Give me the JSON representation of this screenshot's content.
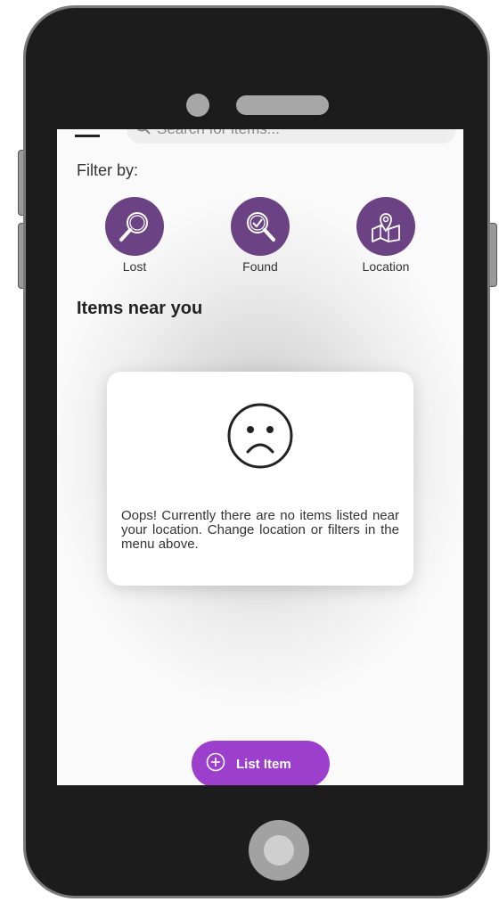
{
  "search": {
    "placeholder": "Search for items..."
  },
  "filter": {
    "label": "Filter by:",
    "items": [
      {
        "label": "Lost",
        "icon": "magnifier-icon"
      },
      {
        "label": "Found",
        "icon": "magnifier-check-icon"
      },
      {
        "label": "Location",
        "icon": "map-pin-icon"
      }
    ]
  },
  "section": {
    "title": "Items near you"
  },
  "empty_state": {
    "icon": "sad-face-icon",
    "message": "Oops! Currently there are no items listed near your location. Change location or filters in the menu above."
  },
  "fab": {
    "label": "List Item",
    "icon": "plus-circle-icon"
  },
  "colors": {
    "filter_circle": "#6b4384",
    "fab": "#9b3fcc"
  }
}
